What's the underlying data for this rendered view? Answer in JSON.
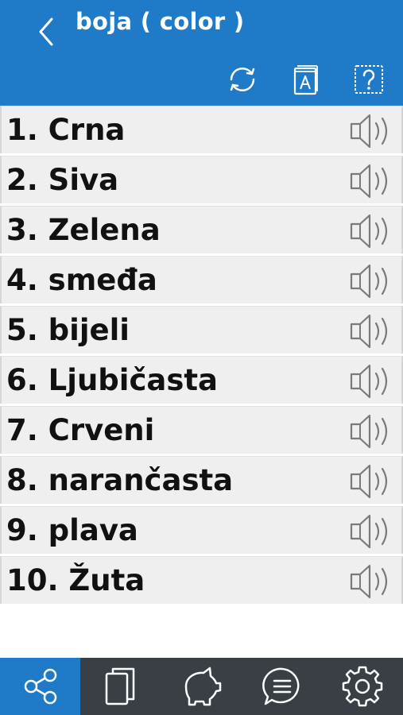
{
  "header": {
    "title": "boja ( color )",
    "back_icon": "chevron-left-icon",
    "actions": [
      "refresh-icon",
      "dictionary-icon",
      "help-icon"
    ],
    "background_color": "#1f7ac7"
  },
  "items": [
    {
      "label": "1. Crna"
    },
    {
      "label": "2. Siva"
    },
    {
      "label": "3. Zelena"
    },
    {
      "label": "4. smeđa"
    },
    {
      "label": "5. bijeli"
    },
    {
      "label": "6. Ljubičasta"
    },
    {
      "label": "7. Crveni"
    },
    {
      "label": "8. narančasta"
    },
    {
      "label": "9. plava"
    },
    {
      "label": "10. Žuta"
    }
  ],
  "tabbar": {
    "tabs": [
      "share-icon",
      "flashcards-icon",
      "piggy-bank-icon",
      "chat-icon",
      "settings-icon"
    ],
    "active_tab": "share-icon",
    "background_color": "#3a3f45"
  }
}
